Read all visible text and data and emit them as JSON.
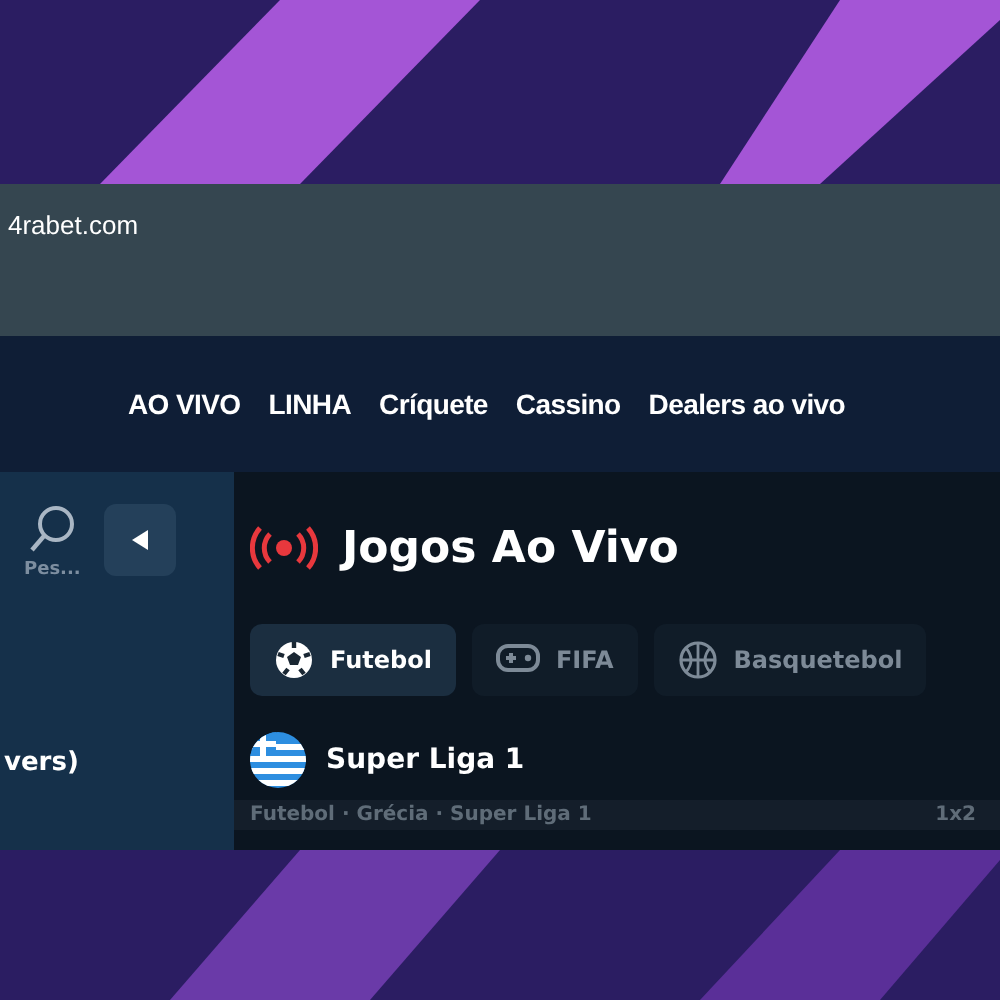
{
  "browser": {
    "address": "4rabet.com"
  },
  "nav": {
    "items": [
      "AO VIVO",
      "LINHA",
      "Críquete",
      "Cassino",
      "Dealers ao vivo"
    ]
  },
  "sidebar": {
    "search_label": "Pes...",
    "item_text": "vers)"
  },
  "main": {
    "title": "Jogos Ao Vivo",
    "sports": [
      {
        "label": "Futebol",
        "kind": "football",
        "selected": true
      },
      {
        "label": "FIFA",
        "kind": "fifa",
        "selected": false
      },
      {
        "label": "Basquetebol",
        "kind": "basketball",
        "selected": false
      }
    ],
    "league": {
      "name": "Super Liga 1",
      "breadcrumb": "Futebol · Grécia · Super Liga 1",
      "market": "1x2"
    }
  }
}
